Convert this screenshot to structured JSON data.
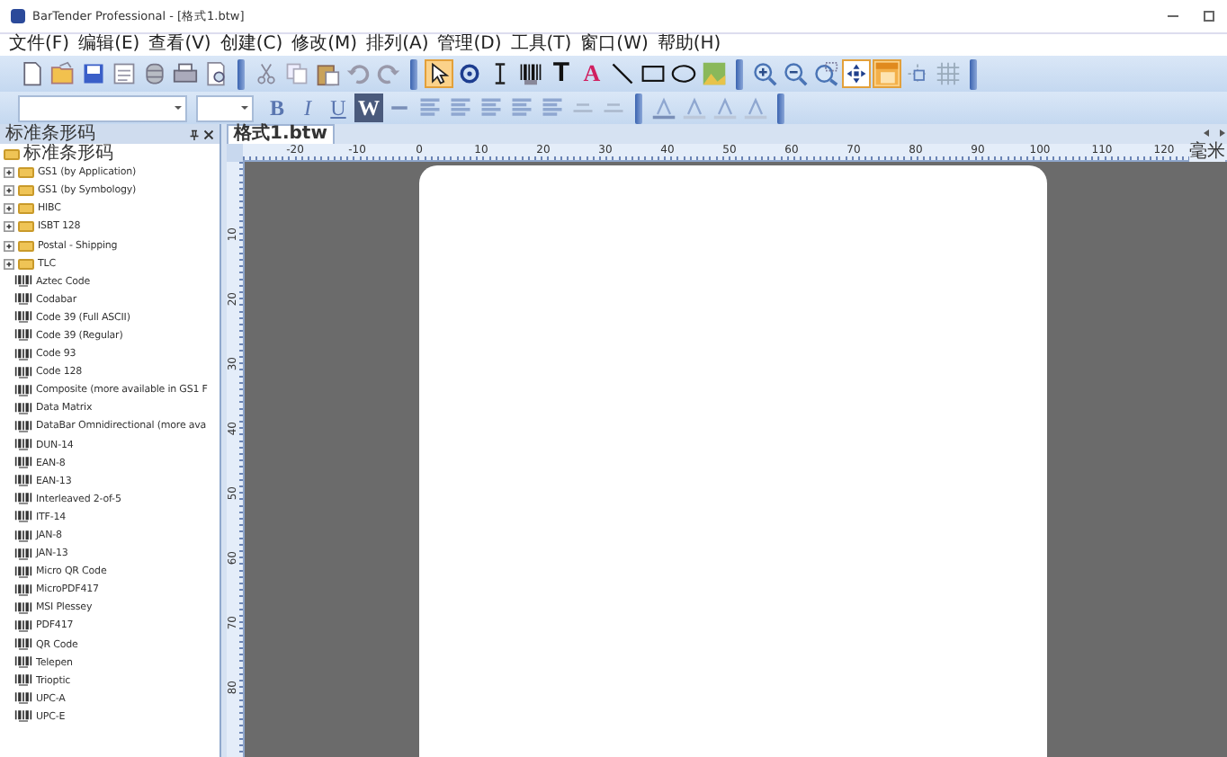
{
  "window": {
    "title": "BarTender Professional - [格式1.btw]"
  },
  "menu": [
    "文件(F)",
    "编辑(E)",
    "查看(V)",
    "创建(C)",
    "修改(M)",
    "排列(A)",
    "管理(D)",
    "工具(T)",
    "窗口(W)",
    "帮助(H)"
  ],
  "toolbar_main": [
    {
      "kind": "new",
      "selected": false
    },
    {
      "kind": "open",
      "selected": false
    },
    {
      "kind": "save",
      "selected": false
    },
    {
      "kind": "page",
      "selected": false
    },
    {
      "kind": "database",
      "selected": false
    },
    {
      "kind": "print",
      "selected": false
    },
    {
      "kind": "preview",
      "selected": false
    },
    {
      "kind": "sep"
    },
    {
      "kind": "cut",
      "selected": false
    },
    {
      "kind": "copy",
      "selected": false
    },
    {
      "kind": "paste",
      "selected": false
    },
    {
      "kind": "undo",
      "selected": false
    },
    {
      "kind": "redo",
      "selected": false
    },
    {
      "kind": "sep"
    },
    {
      "kind": "pointer",
      "selected": true
    },
    {
      "kind": "rotate",
      "selected": false
    },
    {
      "kind": "ibeam",
      "selected": false
    },
    {
      "kind": "barcode",
      "selected": false
    },
    {
      "kind": "text",
      "label": "T",
      "selected": false
    },
    {
      "kind": "richtext",
      "label": "A",
      "selected": false
    },
    {
      "kind": "line",
      "selected": false
    },
    {
      "kind": "rect",
      "selected": false
    },
    {
      "kind": "ellipse",
      "selected": false
    },
    {
      "kind": "picture",
      "selected": false
    },
    {
      "kind": "sep"
    },
    {
      "kind": "zoomin",
      "selected": false
    },
    {
      "kind": "zoomout",
      "selected": false
    },
    {
      "kind": "zoomfit",
      "selected": false
    },
    {
      "kind": "fitpage",
      "selected": true
    },
    {
      "kind": "rulers",
      "selected": true
    },
    {
      "kind": "snap",
      "selected": false
    },
    {
      "kind": "grid",
      "selected": false
    }
  ],
  "toolbar_format": [
    {
      "kind": "fontcombo"
    },
    {
      "kind": "sizecombo"
    },
    {
      "kind": "bold",
      "label": "B",
      "selected": false
    },
    {
      "kind": "italic",
      "label": "I",
      "selected": false
    },
    {
      "kind": "underline",
      "label": "U",
      "selected": false
    },
    {
      "kind": "wordwrap",
      "label": "W",
      "selected": true
    },
    {
      "kind": "dash"
    },
    {
      "kind": "align"
    },
    {
      "kind": "align"
    },
    {
      "kind": "align"
    },
    {
      "kind": "align"
    },
    {
      "kind": "align"
    },
    {
      "kind": "spacing"
    },
    {
      "kind": "spacing"
    },
    {
      "kind": "sep"
    },
    {
      "kind": "fontcolor"
    },
    {
      "kind": "fillcolor"
    },
    {
      "kind": "pencolor"
    },
    {
      "kind": "bucket"
    }
  ],
  "panel": {
    "title": "标准条形码",
    "tree": [
      {
        "label": "标准条形码",
        "children": [
          {
            "label": "GS1 (by Application)",
            "kind": "folder",
            "expanded": false
          },
          {
            "label": "GS1 (by Symbology)",
            "kind": "folder",
            "expanded": false
          },
          {
            "label": "HIBC",
            "kind": "folder",
            "expanded": false
          },
          {
            "label": "ISBT 128",
            "kind": "folder",
            "expanded": false
          },
          {
            "label": "Postal - Shipping",
            "kind": "folder",
            "expanded": false
          },
          {
            "label": "TLC",
            "kind": "folder",
            "expanded": false
          },
          {
            "label": "Aztec Code",
            "kind": "barcode"
          },
          {
            "label": "Codabar",
            "kind": "barcode"
          },
          {
            "label": "Code 39 (Full ASCII)",
            "kind": "barcode"
          },
          {
            "label": "Code 39 (Regular)",
            "kind": "barcode"
          },
          {
            "label": "Code 93",
            "kind": "barcode"
          },
          {
            "label": "Code 128",
            "kind": "barcode"
          },
          {
            "label": "Composite (more available in GS1 F",
            "kind": "barcode"
          },
          {
            "label": "Data Matrix",
            "kind": "barcode"
          },
          {
            "label": "DataBar Omnidirectional (more ava",
            "kind": "barcode"
          },
          {
            "label": "DUN-14",
            "kind": "barcode"
          },
          {
            "label": "EAN-8",
            "kind": "barcode"
          },
          {
            "label": "EAN-13",
            "kind": "barcode"
          },
          {
            "label": "Interleaved 2-of-5",
            "kind": "barcode"
          },
          {
            "label": "ITF-14",
            "kind": "barcode"
          },
          {
            "label": "JAN-8",
            "kind": "barcode"
          },
          {
            "label": "JAN-13",
            "kind": "barcode"
          },
          {
            "label": "Micro QR Code",
            "kind": "barcode"
          },
          {
            "label": "MicroPDF417",
            "kind": "barcode"
          },
          {
            "label": "MSI Plessey",
            "kind": "barcode"
          },
          {
            "label": "PDF417",
            "kind": "barcode"
          },
          {
            "label": "QR Code",
            "kind": "barcode"
          },
          {
            "label": "Telepen",
            "kind": "barcode"
          },
          {
            "label": "Trioptic",
            "kind": "barcode"
          },
          {
            "label": "UPC-A",
            "kind": "barcode"
          },
          {
            "label": "UPC-E",
            "kind": "barcode"
          }
        ]
      }
    ]
  },
  "tabs": [
    {
      "label": "格式1.btw",
      "selected": true
    }
  ],
  "ruler": {
    "x_labels": [
      "-20",
      "-10",
      "0",
      "10",
      "20",
      "30",
      "40",
      "50",
      "60",
      "70",
      "80",
      "90",
      "100",
      "110",
      "120"
    ],
    "unit": "毫米",
    "y_labels": [
      "10",
      "20",
      "30",
      "40",
      "50",
      "60",
      "70",
      "80"
    ]
  }
}
